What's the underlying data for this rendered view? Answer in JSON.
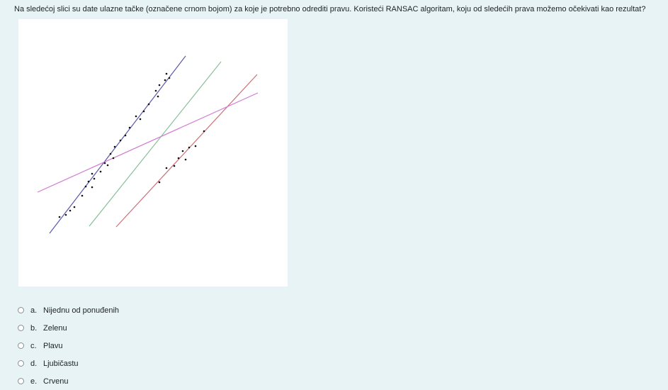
{
  "question": {
    "text": "Na sledećoj slici su date ulazne tačke (označene crnom bojom) za koje je potrebno odrediti pravu. Koristeći RANSAC algoritam, koju od sledećih prava možemo očekivati kao rezultat?"
  },
  "figure": {
    "colors": {
      "blue": "#5a5aa8",
      "green": "#88c09a",
      "purple": "#d27ad2",
      "red": "#cd6f78",
      "points": "#111111"
    }
  },
  "answers": [
    {
      "number": "a.",
      "label": "Nijednu od ponuđenih"
    },
    {
      "number": "b.",
      "label": "Zelenu"
    },
    {
      "number": "c.",
      "label": "Plavu"
    },
    {
      "number": "d.",
      "label": "Ljubičastu"
    },
    {
      "number": "e.",
      "label": "Crvenu"
    }
  ]
}
